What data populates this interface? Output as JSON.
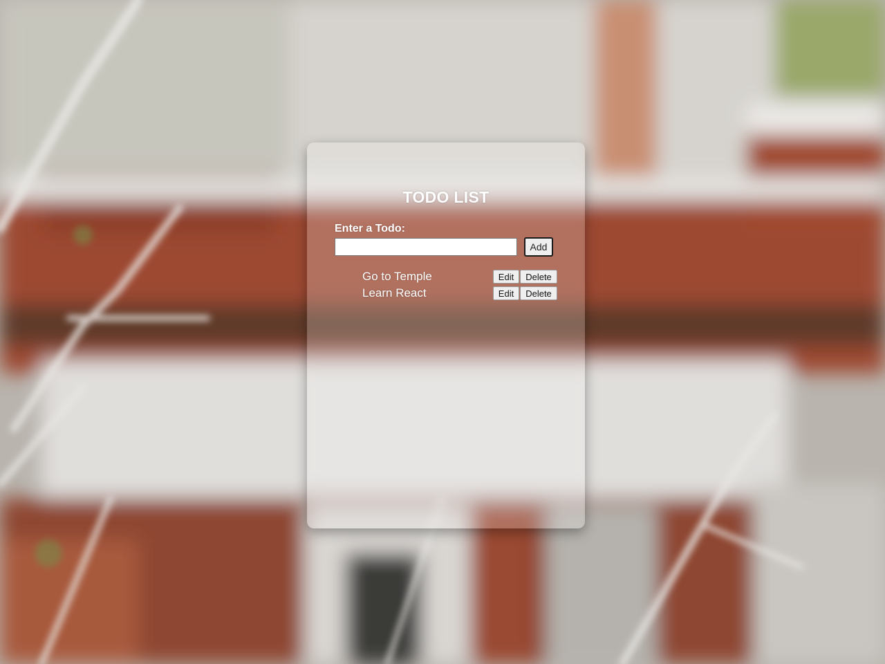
{
  "card": {
    "title": "TODO LIST",
    "input_label": "Enter a Todo:",
    "input_value": "",
    "add_label": "Add"
  },
  "todos": [
    {
      "text": "Go to Temple",
      "edit_label": "Edit",
      "delete_label": "Delete"
    },
    {
      "text": "Learn React",
      "edit_label": "Edit",
      "delete_label": "Delete"
    }
  ]
}
